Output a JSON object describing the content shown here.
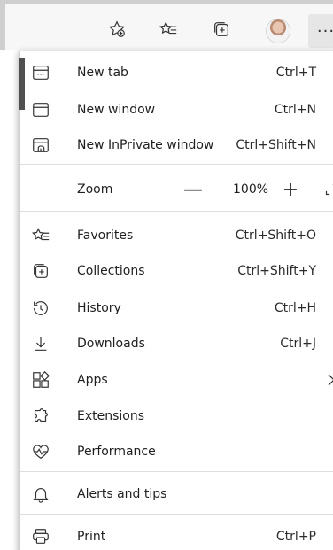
{
  "toolbar": {
    "icons": [
      "add-favorite-icon",
      "favorites-icon",
      "collections-icon",
      "profile-avatar",
      "more-icon"
    ],
    "more_label": "···"
  },
  "menu": {
    "items_top": [
      {
        "label": "New tab",
        "shortcut": "Ctrl+T",
        "icon": "new-tab-icon"
      },
      {
        "label": "New window",
        "shortcut": "Ctrl+N",
        "icon": "new-window-icon"
      },
      {
        "label": "New InPrivate window",
        "shortcut": "Ctrl+Shift+N",
        "icon": "inprivate-icon"
      }
    ],
    "zoom": {
      "label": "Zoom",
      "minus": "—",
      "value": "100%",
      "plus": "+"
    },
    "items_mid": [
      {
        "label": "Favorites",
        "shortcut": "Ctrl+Shift+O",
        "icon": "favorites-icon"
      },
      {
        "label": "Collections",
        "shortcut": "Ctrl+Shift+Y",
        "icon": "collections-icon"
      },
      {
        "label": "History",
        "shortcut": "Ctrl+H",
        "icon": "history-icon"
      },
      {
        "label": "Downloads",
        "shortcut": "Ctrl+J",
        "icon": "downloads-icon"
      },
      {
        "label": "Apps",
        "shortcut": "",
        "icon": "apps-icon"
      },
      {
        "label": "Extensions",
        "shortcut": "",
        "icon": "extensions-icon"
      },
      {
        "label": "Performance",
        "shortcut": "",
        "icon": "performance-icon"
      }
    ],
    "alerts": {
      "label": "Alerts and tips",
      "icon": "bell-icon"
    },
    "print": {
      "label": "Print",
      "shortcut": "Ctrl+P",
      "icon": "printer-icon"
    }
  }
}
